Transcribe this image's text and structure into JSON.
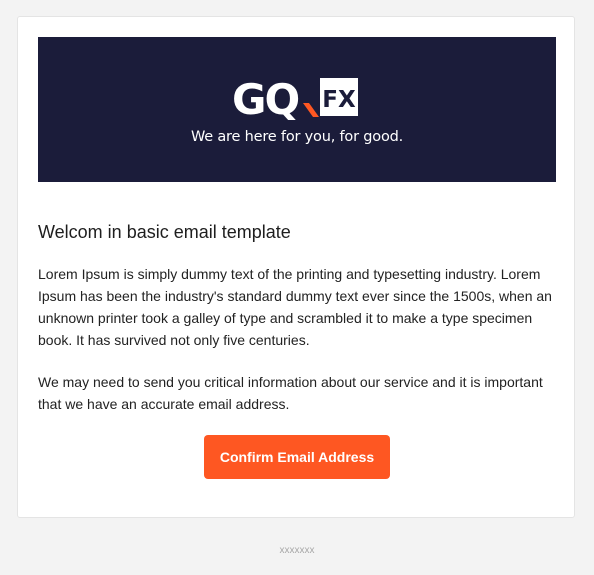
{
  "brand": {
    "logo_main": "GQ",
    "logo_box": "FX",
    "tagline": "We are here for you, for good.",
    "colors": {
      "banner_bg": "#1b1c3a",
      "accent": "#fe5722",
      "text": "#222222"
    }
  },
  "email": {
    "heading": "Welcom in basic email template",
    "paragraph_1": "Lorem Ipsum is simply dummy text of the printing and typesetting industry. Lorem Ipsum has been the industry's standard dummy text ever since the 1500s, when an unknown printer took a galley of type and scrambled it to make a type specimen book. It has survived not only five centuries.",
    "paragraph_2": "We may need to send you critical information about our service and it is important that we have an accurate email address.",
    "cta_label": "Confirm Email Address"
  },
  "footer": {
    "text": "xxxxxxx"
  }
}
